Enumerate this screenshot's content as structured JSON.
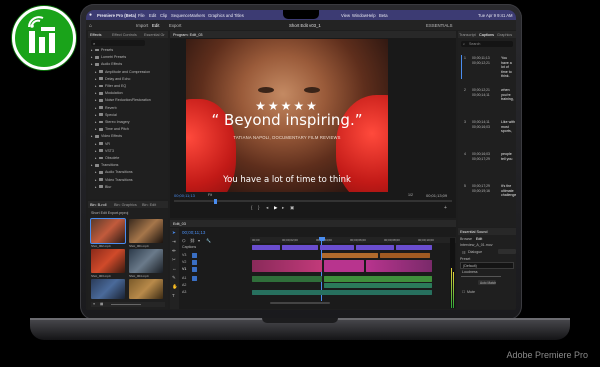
{
  "overlay": {
    "caption": "Adobe Premiere Pro"
  },
  "menubar": {
    "app_name": "Premiere Pro (Beta)",
    "items": [
      "File",
      "Edit",
      "Clip",
      "Sequence",
      "Markers",
      "Graphics and Titles",
      "View",
      "Window",
      "Help",
      "Beta"
    ],
    "time": "Tue Apr 9  9:41 AM"
  },
  "app_header": {
    "tabs": [
      "Import",
      "Edit",
      "Export"
    ],
    "sequence_name": "Short Edit v03_1",
    "workspace": "ESSENTIALS"
  },
  "effects_panel": {
    "tabs": [
      "Effects",
      "Effect Controls",
      "Essential Gr"
    ],
    "items": [
      "Presets",
      "Lumetri Presets",
      "Audio Effects",
      "Amplitude and Compression",
      "Delay and Echo",
      "Filter and EQ",
      "Modulation",
      "Noise Reduction/Restoration",
      "Reverb",
      "Special",
      "Stereo Imagery",
      "Time and Pitch",
      "Video Effects",
      "VR",
      "VST3",
      "Obsolete",
      "Transitions",
      "Audio Transitions",
      "Video Transitions",
      "Blur"
    ]
  },
  "project_panel": {
    "tabs": [
      "Bin: B-roll",
      "Bin: Graphics",
      "Bin: Edit"
    ],
    "title": "Short Edit Export.prproj",
    "thumb_labels": [
      "Shot_002.mp4",
      "Shot_001.mp4",
      "Shot_003.mp4",
      "Shot_004.mp4",
      "Shot_005.mp4",
      "Shot_006.mp4"
    ]
  },
  "program_monitor": {
    "title": "Program: Edit_03",
    "stars": "★★★★★",
    "quote": "“ Beyond inspiring.”",
    "credit": "TATIANA NAPOLI, DOCUMENTARY FILM REVIEWS",
    "subtitle": "You have a lot of time to think",
    "timecode": "00;00;11;13",
    "fit": "Fit",
    "quality": "1/2",
    "duration": "00;01;13;09"
  },
  "timeline": {
    "tab": "Edit_03",
    "timecode": "00;00;11;13",
    "ruler": [
      "00;00",
      "00;00;02;00",
      "00;00;04;00",
      "00;00;06;00",
      "00;00;08;00",
      "00;00;10;00"
    ],
    "tracks": [
      "Captions",
      "V3",
      "V2",
      "V1",
      "A1",
      "A2",
      "A3"
    ]
  },
  "text_panel": {
    "tabs": [
      "Transcript",
      "Captions",
      "Graphics"
    ],
    "search_placeholder": "Search",
    "captions": [
      {
        "num": "1",
        "time_in": "00;00;11;13",
        "time_out": "00;00;12;21",
        "text": "You have a lot of time to think."
      },
      {
        "num": "2",
        "time_in": "00;00;12;21",
        "time_out": "00;00;14;11",
        "text": "when you're training,"
      },
      {
        "num": "3",
        "time_in": "00;00;14;11",
        "time_out": "00;00;16;03",
        "text": "Like with most sports,"
      },
      {
        "num": "4",
        "time_in": "00;00;16;03",
        "time_out": "00;00;17;29",
        "text": "people tell you"
      },
      {
        "num": "5",
        "time_in": "00;00;17;29",
        "time_out": "00;00;19;16",
        "text": "it's the ultimate challenge"
      }
    ]
  },
  "essential_sound": {
    "tab": "Essential Sound",
    "sub_tabs": [
      "Browse",
      "Edit"
    ],
    "clip": "Interview_A_01.mov",
    "dialogue": "Dialogue",
    "preset_label": "Preset",
    "preset": "(Default)",
    "loudness": "Loudness",
    "auto_match": "Auto Match",
    "mute": "Mute"
  },
  "colors": {
    "accent": "#4a8df0",
    "menubar": "#3c3b73",
    "glove": "#d8221e",
    "logo_green": "#1aa31a",
    "clip_pink": "#b8348e",
    "clip_green": "#3f8f3c"
  }
}
